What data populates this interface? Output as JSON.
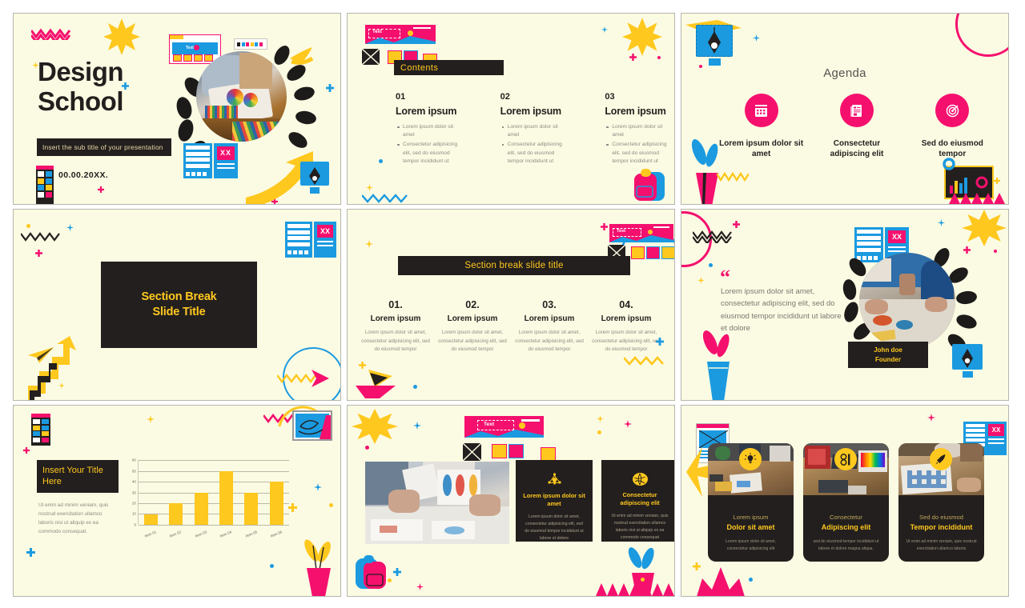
{
  "theme": {
    "slide_bg": "#fbfbe3",
    "dark": "#231f1e",
    "yellow": "#ffc81e",
    "pink": "#f5106e",
    "blue": "#1b9ae0",
    "muted_text": "#8c8c84"
  },
  "slides": [
    {
      "name": "title-slide",
      "title_line1": "Design",
      "title_line2": "School",
      "subtitle": "Insert the sub title of your presentation",
      "date": "00.00.20XX.",
      "mockup_text": "Text"
    },
    {
      "name": "contents-slide",
      "heading": "Contents",
      "mockup_text": "Text",
      "columns": [
        {
          "number": "01",
          "heading": "Lorem ipsum",
          "bullets": [
            "Lorem ipsum dolor sit amet",
            "Consectetur adipisicing elit, sed do eiusmod tempor incididunt ut"
          ]
        },
        {
          "number": "02",
          "heading": "Lorem ipsum",
          "bullets": [
            "Lorem ipsum dolor sit amet",
            "Consectetur adipisicing elit, sed do eiusmod tempor incididunt ut"
          ]
        },
        {
          "number": "03",
          "heading": "Lorem ipsum",
          "bullets": [
            "Lorem ipsum dolor sit amet",
            "Consectetur adipisicing elit, sed do eiusmod tempor incididunt ut"
          ]
        }
      ]
    },
    {
      "name": "agenda-slide",
      "heading": "Agenda",
      "items": [
        {
          "icon": "calendar-icon",
          "label": "Lorem ipsum dolor sit amet"
        },
        {
          "icon": "document-list-icon",
          "label": "Consectetur adipiscing elit"
        },
        {
          "icon": "target-icon",
          "label": "Sed do eiusmod tempor"
        }
      ]
    },
    {
      "name": "section-break-slide",
      "title_line1": "Section Break",
      "title_line2": "Slide Title"
    },
    {
      "name": "section-break-four-items-slide",
      "heading": "Section break slide title",
      "items": [
        {
          "number": "01.",
          "heading": "Lorem ipsum",
          "body": "Lorem ipsum dolor sit amet, consectetur adipisicing elit, sed do eiusmod tempor"
        },
        {
          "number": "02.",
          "heading": "Lorem ipsum",
          "body": "Lorem ipsum dolor sit amet, consectetur adipisicing elit, sed do eiusmod tempor"
        },
        {
          "number": "03.",
          "heading": "Lorem ipsum",
          "body": "Lorem ipsum dolor sit amet, consectetur adipisicing elit, sed do eiusmod tempor"
        },
        {
          "number": "04.",
          "heading": "Lorem ipsum",
          "body": "Lorem ipsum dolor sit amet, consectetur adipisicing elit, sed do eiusmod tempor"
        }
      ]
    },
    {
      "name": "quote-slide",
      "quote_mark": "“",
      "quote": "Lorem ipsum dolor sit amet, consectetur adipiscing elit, sed do eiusmod tempor incididunt ut labore et dolore",
      "author_name": "John doe",
      "author_role": "Founder"
    },
    {
      "name": "chart-slide",
      "title": "Insert Your Title Here",
      "body": "Ut enim ad minim veniam, quis nostrud exercitation ullamco laboris nisi ut aliquip ex ea commodo consequat."
    },
    {
      "name": "image-and-cards-slide",
      "mockup_text": "Text",
      "cards": [
        {
          "icon": "lightbulb-network-icon",
          "heading": "Lorem ipsum dolor sit amet",
          "body": "Lorem ipsum dolor sit amet, consectetur adipisicing elit, sed do eiusmod tempor incididunt ut labore et dolore"
        },
        {
          "icon": "globe-icon",
          "heading": "Consectetur adipiscing elit",
          "body": "Ut enim ad minim veniam, quis nostrud exercitation ullamco laboris nisi ut aliquip ex ea commodo consequat"
        }
      ]
    },
    {
      "name": "three-photo-cards-slide",
      "cards": [
        {
          "icon": "lightbulb-icon",
          "subheading": "Lorem ipsum",
          "heading": "Dolor sit amet",
          "body": "Lorem ipsum dolor sit amet, consectetur adipisicing elit"
        },
        {
          "icon": "design-tool-icon",
          "subheading": "Consectetur",
          "heading": "Adipiscing elit",
          "body": "sed do eiusmod tempor incididunt ut labore et dolore magna aliqua."
        },
        {
          "icon": "rocket-icon",
          "subheading": "Sed do eiusmod",
          "heading": "Tempor incididunt",
          "body": "Ut enim ad minim veniam, quis nostrud exercitation ullamco laboris"
        }
      ]
    }
  ],
  "chart_data": {
    "type": "bar",
    "title": "Insert Your Title Here",
    "categories": [
      "Item 01",
      "Item 02",
      "Item 03",
      "Item 04",
      "Item 05",
      "Item 06"
    ],
    "values": [
      10,
      20,
      30,
      50,
      30,
      40
    ],
    "yticks": [
      0,
      10,
      20,
      30,
      40,
      50,
      60
    ],
    "ylim": [
      0,
      60
    ],
    "xlabel": "",
    "ylabel": "",
    "grid": true,
    "legend": "none",
    "bar_color": "#ffc81e"
  }
}
